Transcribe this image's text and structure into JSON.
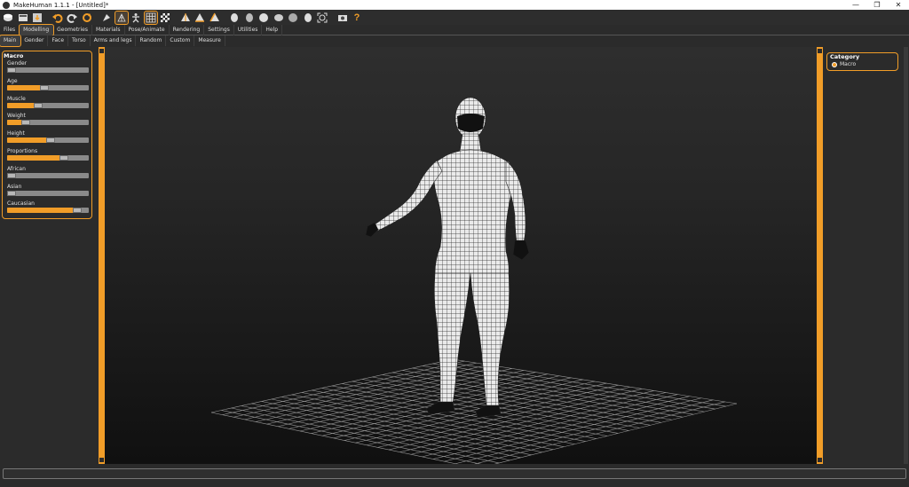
{
  "window": {
    "title": "MakeHuman 1.1.1 - [Untitled]*"
  },
  "window_controls": {
    "minimize": "—",
    "maximize": "❐",
    "close": "✕"
  },
  "toolbar": {
    "icons": [
      "save-icon",
      "load-icon",
      "export-icon",
      "undo-icon",
      "redo-icon",
      "reset-icon",
      "smooth-icon",
      "wireframe-icon",
      "pose-icon",
      "grid-icon",
      "checker-background-icon",
      "front-view-icon",
      "back-view-icon",
      "side-view-icon",
      "left-view-icon",
      "right-view-icon",
      "top-view-icon",
      "bottom-view-icon",
      "reset-camera-icon",
      "screenshot-icon",
      "help-icon"
    ],
    "help_label": "?"
  },
  "main_tabs": [
    {
      "label": "Files"
    },
    {
      "label": "Modelling",
      "active": true
    },
    {
      "label": "Geometries"
    },
    {
      "label": "Materials"
    },
    {
      "label": "Pose/Animate"
    },
    {
      "label": "Rendering"
    },
    {
      "label": "Settings"
    },
    {
      "label": "Utilities"
    },
    {
      "label": "Help"
    }
  ],
  "sub_tabs": [
    {
      "label": "Main",
      "active": true
    },
    {
      "label": "Gender"
    },
    {
      "label": "Face"
    },
    {
      "label": "Torso"
    },
    {
      "label": "Arms and legs"
    },
    {
      "label": "Random"
    },
    {
      "label": "Custom"
    },
    {
      "label": "Measure"
    }
  ],
  "macro": {
    "title": "Macro",
    "sliders": [
      {
        "label": "Gender",
        "value": 0.0
      },
      {
        "label": "Age",
        "value": 0.45
      },
      {
        "label": "Muscle",
        "value": 0.36
      },
      {
        "label": "Weight",
        "value": 0.2
      },
      {
        "label": "Height",
        "value": 0.54
      },
      {
        "label": "Proportions",
        "value": 0.72
      },
      {
        "label": "African",
        "value": 0.0
      },
      {
        "label": "Asian",
        "value": 0.0
      },
      {
        "label": "Caucasian",
        "value": 0.9
      }
    ]
  },
  "category": {
    "title": "Category",
    "option": "Macro"
  },
  "colors": {
    "accent": "#f19d28",
    "panel": "#2b2b2b"
  }
}
